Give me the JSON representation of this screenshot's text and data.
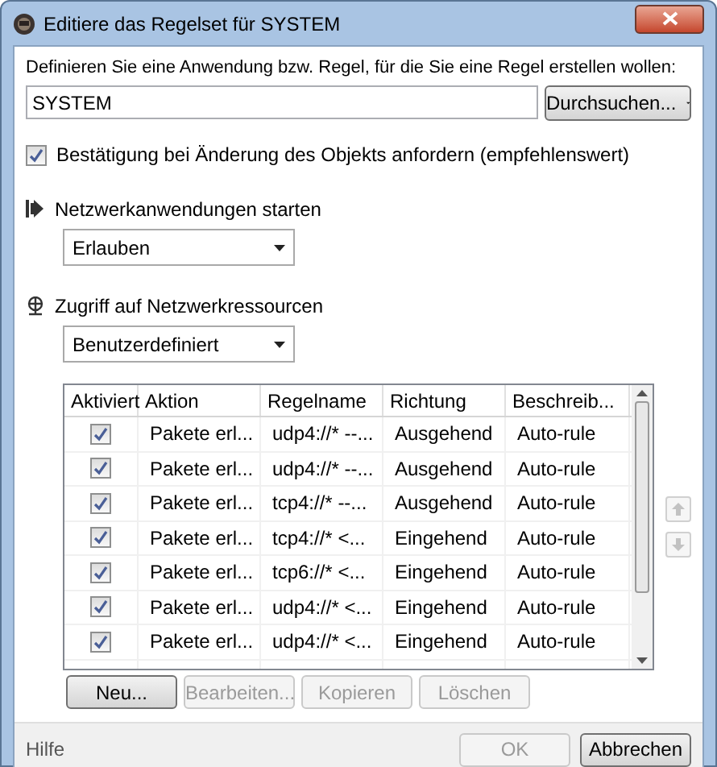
{
  "window": {
    "title": "Editiere das Regelset für SYSTEM"
  },
  "application": {
    "label": "Definieren Sie eine Anwendung bzw. Regel, für die Sie eine Regel erstellen wollen:",
    "value": "SYSTEM",
    "browse_button": "Durchsuchen..."
  },
  "confirm_checkbox": {
    "label": "Bestätigung bei Änderung des Objekts anfordern (empfehlenswert)",
    "checked": true
  },
  "sections": [
    {
      "kind": "launch",
      "title": "Netzwerkanwendungen starten",
      "dropdown": "Erlauben"
    },
    {
      "kind": "network",
      "title": "Zugriff auf Netzwerkressourcen",
      "dropdown": "Benutzerdefiniert"
    }
  ],
  "table": {
    "columns": [
      "Aktiviert",
      "Aktion",
      "Regelname",
      "Richtung",
      "Beschreib..."
    ],
    "rows": [
      {
        "cells": [
          {
            "kind": "checkbox",
            "checked": true
          },
          {
            "kind": "text",
            "text": "Pakete erl..."
          },
          {
            "kind": "text",
            "text": "udp4://* --..."
          },
          {
            "kind": "text",
            "text": "Ausgehend"
          },
          {
            "kind": "text",
            "text": "Auto-rule"
          }
        ]
      },
      {
        "cells": [
          {
            "kind": "checkbox",
            "checked": true
          },
          {
            "kind": "text",
            "text": "Pakete erl..."
          },
          {
            "kind": "text",
            "text": "udp4://* --..."
          },
          {
            "kind": "text",
            "text": "Ausgehend"
          },
          {
            "kind": "text",
            "text": "Auto-rule"
          }
        ]
      },
      {
        "cells": [
          {
            "kind": "checkbox",
            "checked": true
          },
          {
            "kind": "text",
            "text": "Pakete erl..."
          },
          {
            "kind": "text",
            "text": "tcp4://* --..."
          },
          {
            "kind": "text",
            "text": "Ausgehend"
          },
          {
            "kind": "text",
            "text": "Auto-rule"
          }
        ]
      },
      {
        "cells": [
          {
            "kind": "checkbox",
            "checked": true
          },
          {
            "kind": "text",
            "text": "Pakete erl..."
          },
          {
            "kind": "text",
            "text": "tcp4://* <..."
          },
          {
            "kind": "text",
            "text": "Eingehend"
          },
          {
            "kind": "text",
            "text": "Auto-rule"
          }
        ]
      },
      {
        "cells": [
          {
            "kind": "checkbox",
            "checked": true
          },
          {
            "kind": "text",
            "text": "Pakete erl..."
          },
          {
            "kind": "text",
            "text": "tcp6://* <..."
          },
          {
            "kind": "text",
            "text": "Eingehend"
          },
          {
            "kind": "text",
            "text": "Auto-rule"
          }
        ]
      },
      {
        "cells": [
          {
            "kind": "checkbox",
            "checked": true
          },
          {
            "kind": "text",
            "text": "Pakete erl..."
          },
          {
            "kind": "text",
            "text": "udp4://* <..."
          },
          {
            "kind": "text",
            "text": "Eingehend"
          },
          {
            "kind": "text",
            "text": "Auto-rule"
          }
        ]
      },
      {
        "cells": [
          {
            "kind": "checkbox",
            "checked": true
          },
          {
            "kind": "text",
            "text": "Pakete erl..."
          },
          {
            "kind": "text",
            "text": "udp4://* <..."
          },
          {
            "kind": "text",
            "text": "Eingehend"
          },
          {
            "kind": "text",
            "text": "Auto-rule"
          }
        ]
      }
    ]
  },
  "move_buttons": [
    {
      "kind": "up",
      "disabled": true
    },
    {
      "kind": "down",
      "disabled": true
    }
  ],
  "table_buttons": [
    {
      "label": "Neu...",
      "disabled": false
    },
    {
      "label": "Bearbeiten...",
      "disabled": true
    },
    {
      "label": "Kopieren",
      "disabled": true
    },
    {
      "label": "Löschen",
      "disabled": true
    }
  ],
  "footer": {
    "help": "Hilfe",
    "buttons": [
      {
        "label": "OK",
        "disabled": true
      },
      {
        "label": "Abbrechen",
        "disabled": false
      }
    ]
  }
}
